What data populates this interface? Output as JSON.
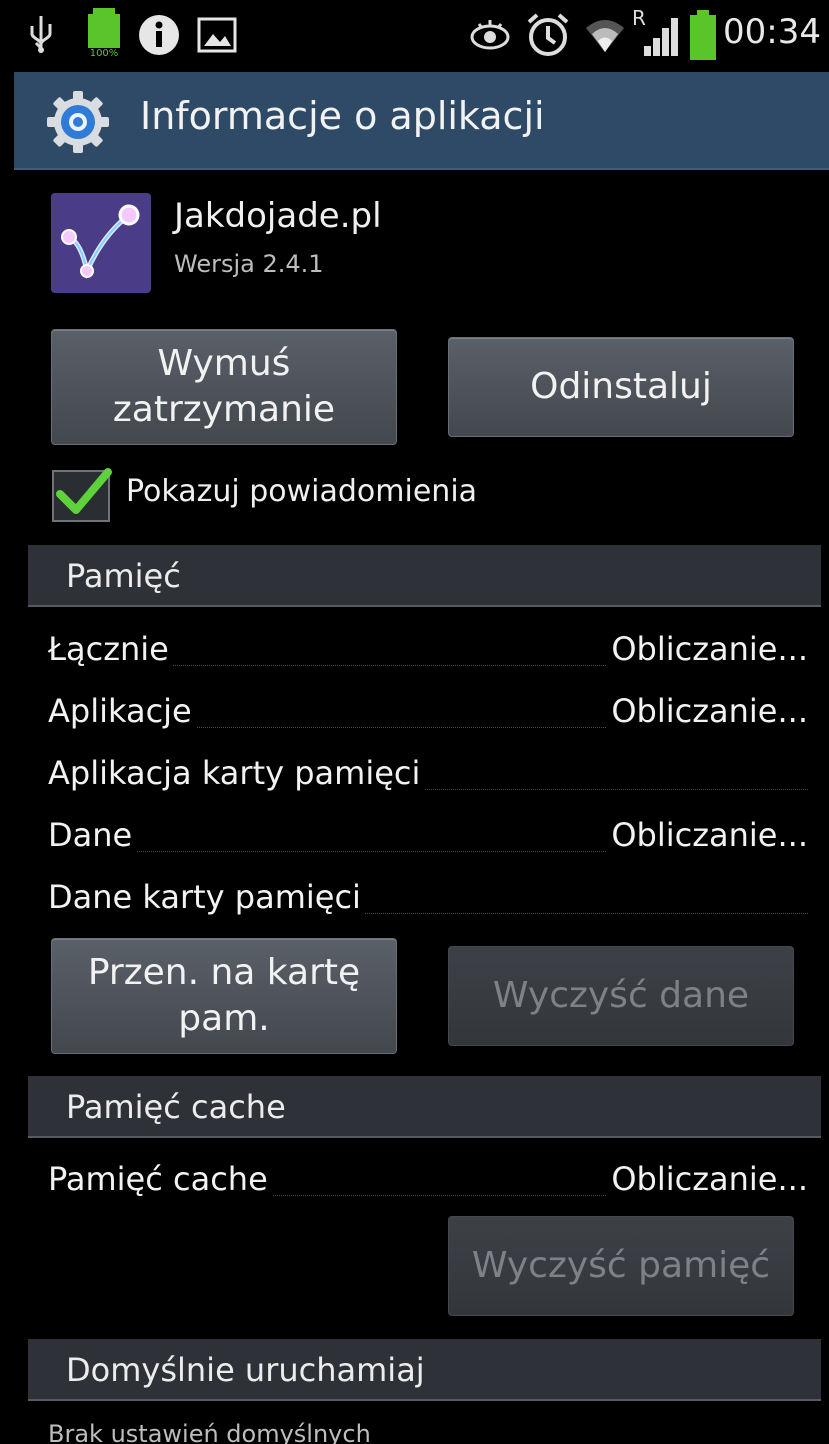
{
  "status_bar": {
    "time": "00:34",
    "battery_small_label": "100%",
    "signal_label": "R",
    "icons": [
      "usb-icon",
      "battery-icon",
      "info-icon",
      "gallery-icon",
      "smart-stay-eye-icon",
      "alarm-icon",
      "wifi-icon",
      "signal-icon",
      "battery-icon"
    ]
  },
  "action_bar": {
    "title": "Informacje o aplikacji",
    "icon": "settings-gear-icon"
  },
  "app": {
    "name": "Jakdojade.pl",
    "version": "Wersja 2.4.1",
    "icon": "app-route-icon"
  },
  "buttons": {
    "force_stop_line1": "Wymuś",
    "force_stop_line2": "zatrzymanie",
    "uninstall": "Odinstaluj",
    "move_to_card_line1": "Przen. na kartę",
    "move_to_card_line2": "pam.",
    "clear_data": "Wyczyść dane",
    "clear_cache": "Wyczyść pamięć"
  },
  "notifications": {
    "label": "Pokazuj powiadomienia",
    "checked": true
  },
  "sections": {
    "storage": "Pamięć",
    "cache": "Pamięć cache",
    "launch_default": "Domyślnie uruchamiaj"
  },
  "storage_rows": [
    {
      "label": "Łącznie",
      "value": "Obliczanie..."
    },
    {
      "label": "Aplikacje",
      "value": "Obliczanie..."
    },
    {
      "label": "Aplikacja karty pamięci",
      "value": ""
    },
    {
      "label": "Dane",
      "value": "Obliczanie..."
    },
    {
      "label": "Dane karty pamięci",
      "value": ""
    }
  ],
  "cache_row": {
    "label": "Pamięć cache",
    "value": "Obliczanie..."
  },
  "launch_default_text": "Brak ustawień domyślnych",
  "colors": {
    "action_bar": "#2e4a66",
    "section_header": "#2e3238",
    "checkmark": "#5fd13a",
    "battery": "#59c52a"
  }
}
